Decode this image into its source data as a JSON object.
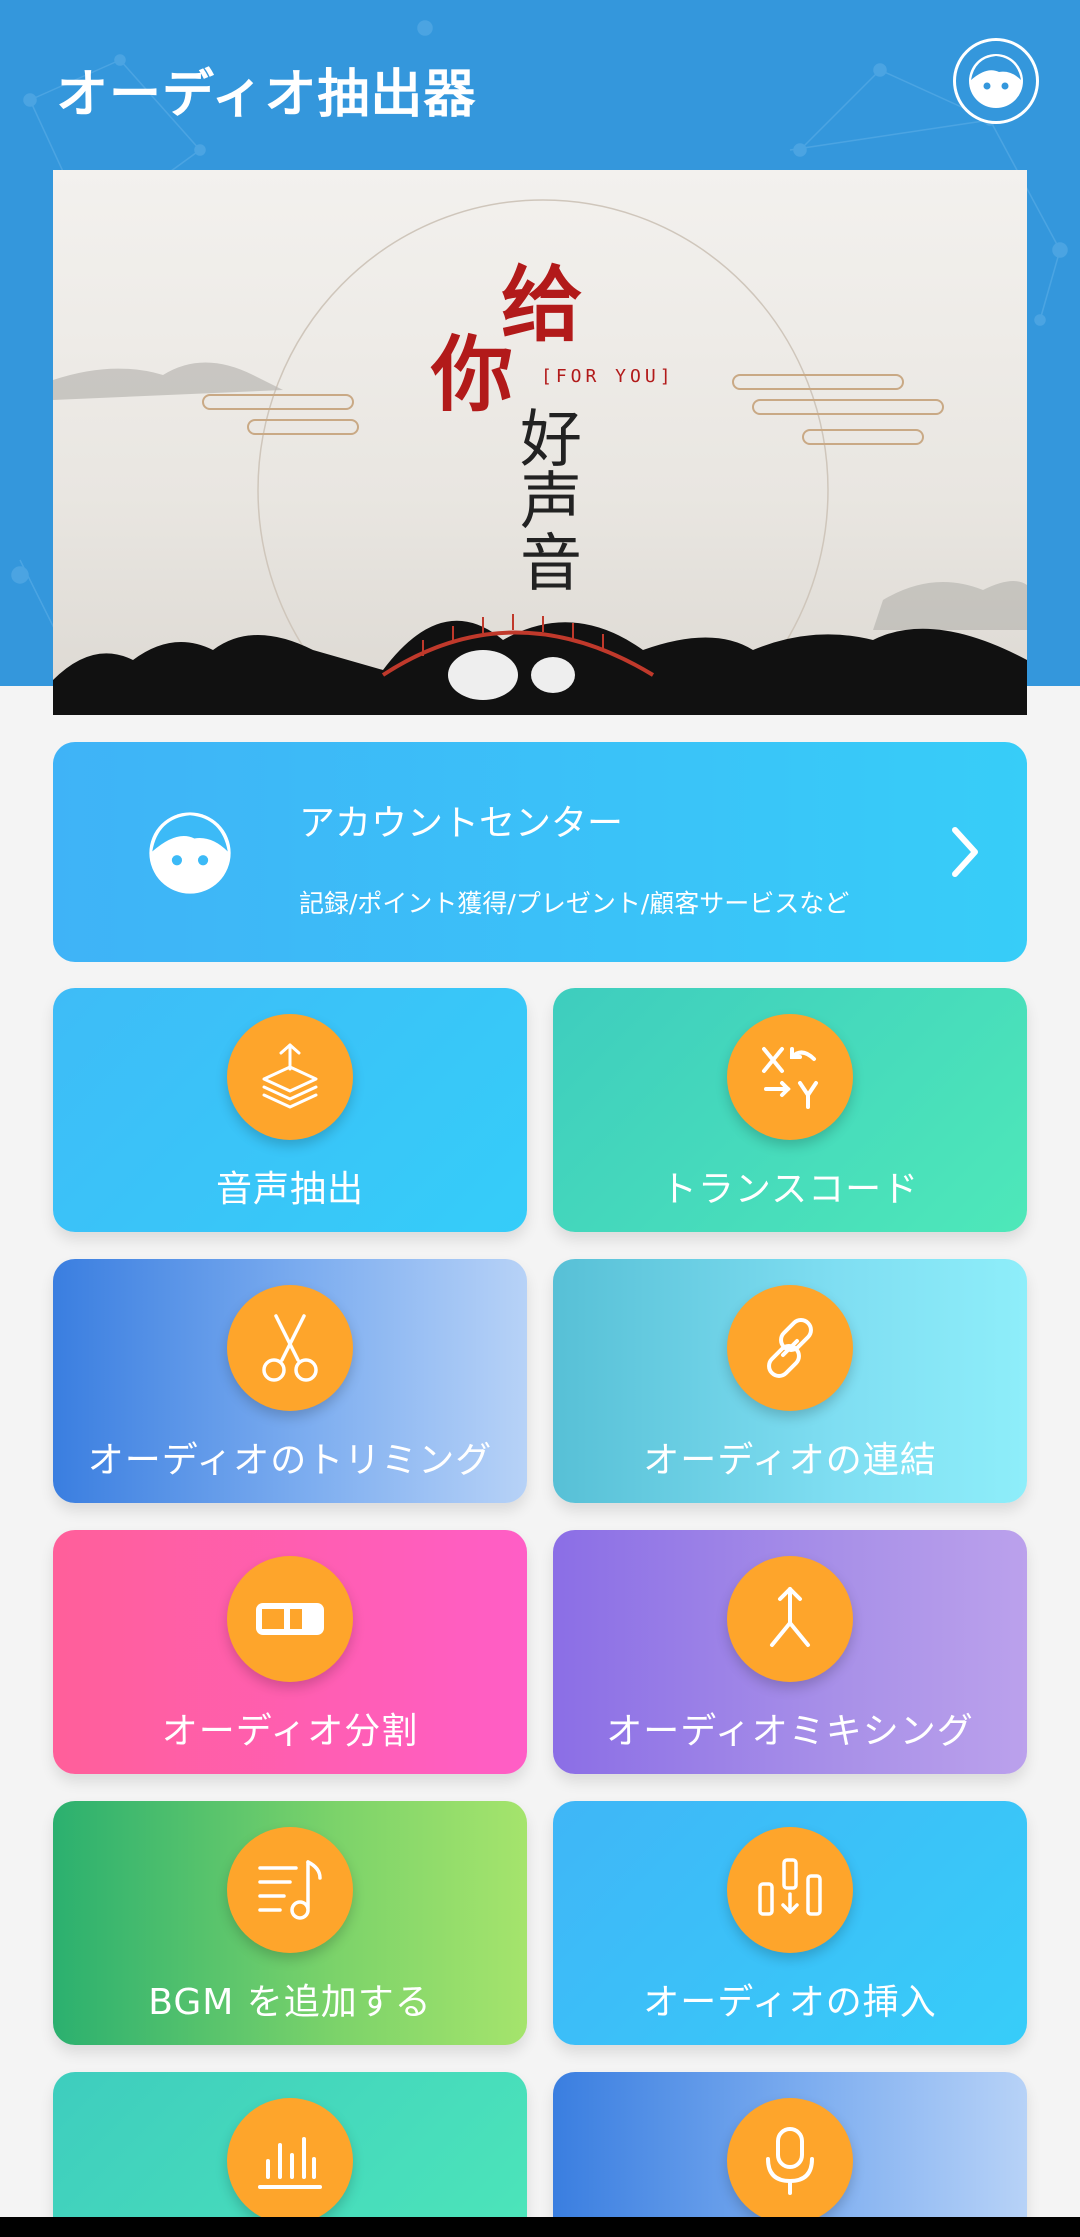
{
  "header": {
    "app_title": "オーディオ抽出器",
    "bg_color": "#3497dc",
    "avatar_icon": "user-avatar-icon"
  },
  "banner": {
    "char_1": "给",
    "char_2": "你",
    "tagline": "[FOR YOU]",
    "char_3": "好声音"
  },
  "account": {
    "title": "アカウントセンター",
    "subtitle": "記録/ポイント獲得/プレゼント/顧客サービスなど",
    "icon": "user-avatar-icon",
    "chevron": "chevron-right-icon"
  },
  "tiles": [
    {
      "label": "音声抽出",
      "icon": "upload-layers-icon"
    },
    {
      "label": "トランスコード",
      "icon": "x-to-y-icon"
    },
    {
      "label": "オーディオのトリミング",
      "icon": "scissors-icon"
    },
    {
      "label": "オーディオの連結",
      "icon": "link-icon"
    },
    {
      "label": "オーディオ分割",
      "icon": "split-battery-icon"
    },
    {
      "label": "オーディオミキシング",
      "icon": "merge-arrow-icon"
    },
    {
      "label": "BGM を追加する",
      "icon": "music-list-icon"
    },
    {
      "label": "オーディオの挿入",
      "icon": "insert-bars-icon"
    },
    {
      "label": "",
      "icon": "equalizer-icon"
    },
    {
      "label": "",
      "icon": "microphone-icon"
    }
  ],
  "colors": {
    "accent_orange": "#fea52b",
    "page_bg": "#f4f4f4"
  }
}
